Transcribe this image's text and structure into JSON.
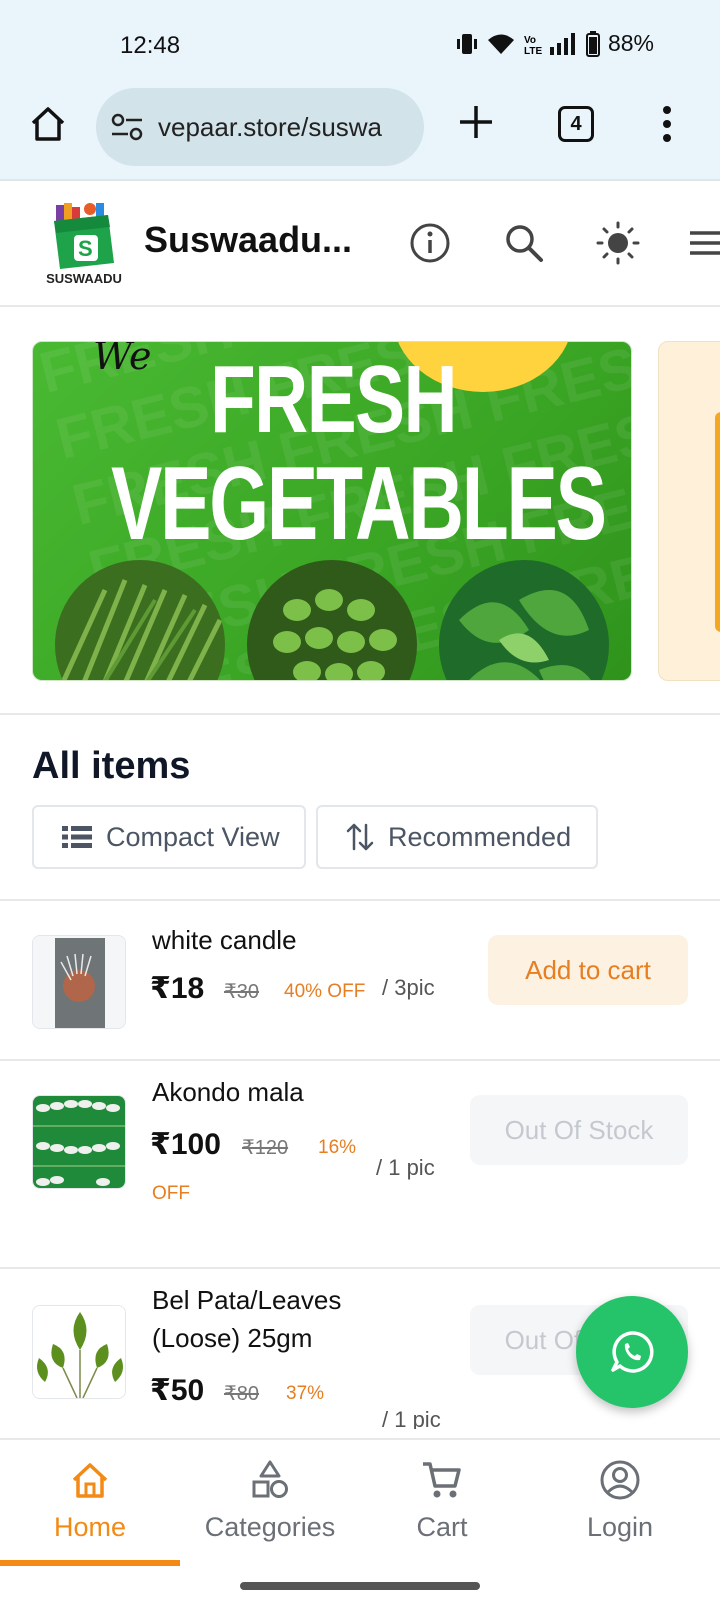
{
  "status_bar": {
    "time": "12:48",
    "battery": "88%"
  },
  "browser": {
    "url": "vepaar.store/suswa",
    "tab_count": "4"
  },
  "header": {
    "brand_logo_text": "SUSWAADU",
    "store_title": "Suswaadu..."
  },
  "banners": [
    {
      "script_text": "We",
      "headline_line1": "FRESH",
      "headline_line2": "VEGETABLES",
      "watermark": "FRESH FRESH FRESH"
    }
  ],
  "catalog": {
    "title": "All items",
    "view_toggle_label": "Compact View",
    "sort_label": "Recommended"
  },
  "items": [
    {
      "name": "white candle",
      "price": "₹18",
      "mrp": "₹30",
      "discount": "40% OFF",
      "unit": "/ 3pic",
      "action": "Add to cart"
    },
    {
      "name": "Akondo mala",
      "price": "₹100",
      "mrp": "₹120",
      "discount": "16%",
      "discount_suffix": "OFF",
      "unit": "/ 1 pic",
      "action": "Out Of Stock"
    },
    {
      "name_line1": "Bel Pata/Leaves",
      "name_line2": "(Loose) 25gm",
      "price": "₹50",
      "mrp": "₹80",
      "discount": "37%",
      "unit": "/ 1 pic",
      "action": "Out Of Stock"
    }
  ],
  "bottom_nav": [
    {
      "label": "Home",
      "icon": "home-icon",
      "active": true
    },
    {
      "label": "Categories",
      "icon": "categories-icon",
      "active": false
    },
    {
      "label": "Cart",
      "icon": "cart-icon",
      "active": false
    },
    {
      "label": "Login",
      "icon": "account-icon",
      "active": false
    }
  ],
  "colors": {
    "accent": "#f28a15",
    "whatsapp": "#25c46a",
    "banner_green": "#3aa524"
  }
}
